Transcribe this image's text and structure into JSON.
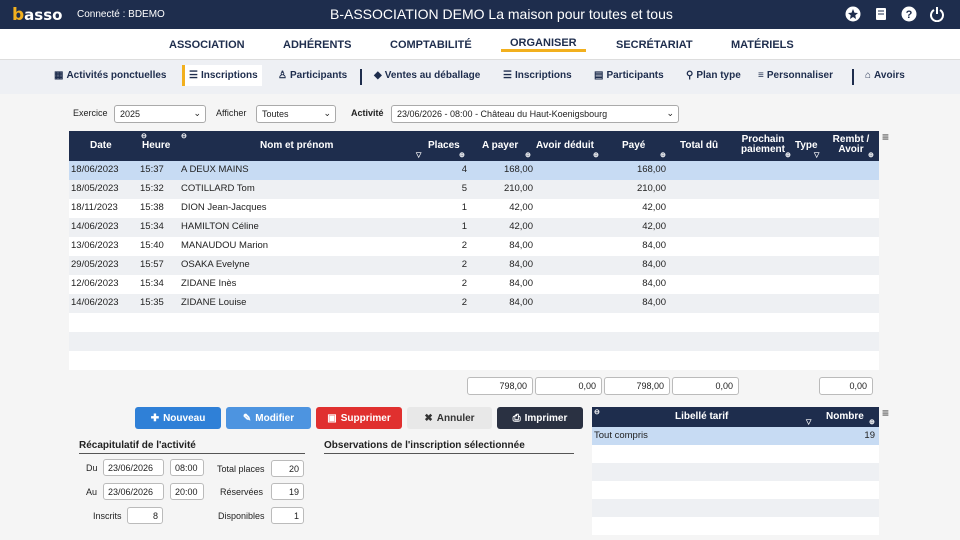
{
  "topbar": {
    "logo": "asso",
    "connected": "Connecté : BDEMO",
    "title": "B-ASSOCIATION DEMO La maison pour toutes et tous"
  },
  "mainnav": [
    "ASSOCIATION",
    "ADHÉRENTS",
    "COMPTABILITÉ",
    "ORGANISER",
    "SECRÉTARIAT",
    "MATÉRIELS"
  ],
  "mainnav_active": "ORGANISER",
  "subnav": {
    "act": "Activités ponctuelles",
    "ins1": "Inscriptions",
    "part1": "Participants",
    "ventes": "Ventes au déballage",
    "ins2": "Inscriptions",
    "part2": "Participants",
    "plan": "Plan type",
    "perso": "Personnaliser",
    "avoirs": "Avoirs"
  },
  "filters": {
    "exercice_label": "Exercice",
    "exercice": "2025",
    "afficher_label": "Afficher",
    "afficher": "Toutes",
    "activite_label": "Activité",
    "activite": "23/06/2026 - 08:00 - Château du Haut-Koenigsbourg"
  },
  "columns": {
    "date": "Date",
    "heure": "Heure",
    "nom": "Nom et prénom",
    "places": "Places",
    "apayer": "A payer",
    "avoir": "Avoir déduit",
    "paye": "Payé",
    "totaldu": "Total dû",
    "prochain": "Prochain paiement",
    "type": "Type",
    "rembt": "Rembt / Avoir"
  },
  "rows": [
    {
      "date": "18/06/2023",
      "heure": "15:37",
      "nom": "A DEUX MAINS",
      "places": "4",
      "apayer": "168,00",
      "paye": "168,00"
    },
    {
      "date": "18/05/2023",
      "heure": "15:32",
      "nom": "COTILLARD Tom",
      "places": "5",
      "apayer": "210,00",
      "paye": "210,00"
    },
    {
      "date": "18/11/2023",
      "heure": "15:38",
      "nom": "DION Jean-Jacques",
      "places": "1",
      "apayer": "42,00",
      "paye": "42,00"
    },
    {
      "date": "14/06/2023",
      "heure": "15:34",
      "nom": "HAMILTON Céline",
      "places": "1",
      "apayer": "42,00",
      "paye": "42,00"
    },
    {
      "date": "13/06/2023",
      "heure": "15:40",
      "nom": "MANAUDOU Marion",
      "places": "2",
      "apayer": "84,00",
      "paye": "84,00"
    },
    {
      "date": "29/05/2023",
      "heure": "15:57",
      "nom": "OSAKA Evelyne",
      "places": "2",
      "apayer": "84,00",
      "paye": "84,00"
    },
    {
      "date": "12/06/2023",
      "heure": "15:34",
      "nom": "ZIDANE Inès",
      "places": "2",
      "apayer": "84,00",
      "paye": "84,00"
    },
    {
      "date": "14/06/2023",
      "heure": "15:35",
      "nom": "ZIDANE Louise",
      "places": "2",
      "apayer": "84,00",
      "paye": "84,00"
    }
  ],
  "totals": {
    "apayer": "798,00",
    "avoir": "0,00",
    "paye": "798,00",
    "totaldu": "0,00",
    "rembt": "0,00"
  },
  "buttons": {
    "nouveau": "Nouveau",
    "modifier": "Modifier",
    "supprimer": "Supprimer",
    "annuler": "Annuler",
    "imprimer": "Imprimer"
  },
  "recap": {
    "title": "Récapitulatif de l'activité",
    "du_label": "Du",
    "du_date": "23/06/2026",
    "du_time": "08:00",
    "au_label": "Au",
    "au_date": "23/06/2026",
    "au_time": "20:00",
    "inscrits_label": "Inscrits",
    "inscrits": "8",
    "total_label": "Total places",
    "total": "20",
    "reservees_label": "Réservées",
    "reservees": "19",
    "dispo_label": "Disponibles",
    "dispo": "1"
  },
  "observations": {
    "title": "Observations de l'inscription sélectionnée"
  },
  "tarifs": {
    "col_libelle": "Libellé tarif",
    "col_nombre": "Nombre",
    "rows": [
      {
        "libelle": "Tout compris",
        "nombre": "19"
      }
    ]
  },
  "colors": {
    "navy": "#1e2d4d",
    "accent": "#f2b01e",
    "blue_btn": "#2f80d7",
    "red_btn": "#e0302f",
    "selected_row": "#c7dbf3"
  }
}
